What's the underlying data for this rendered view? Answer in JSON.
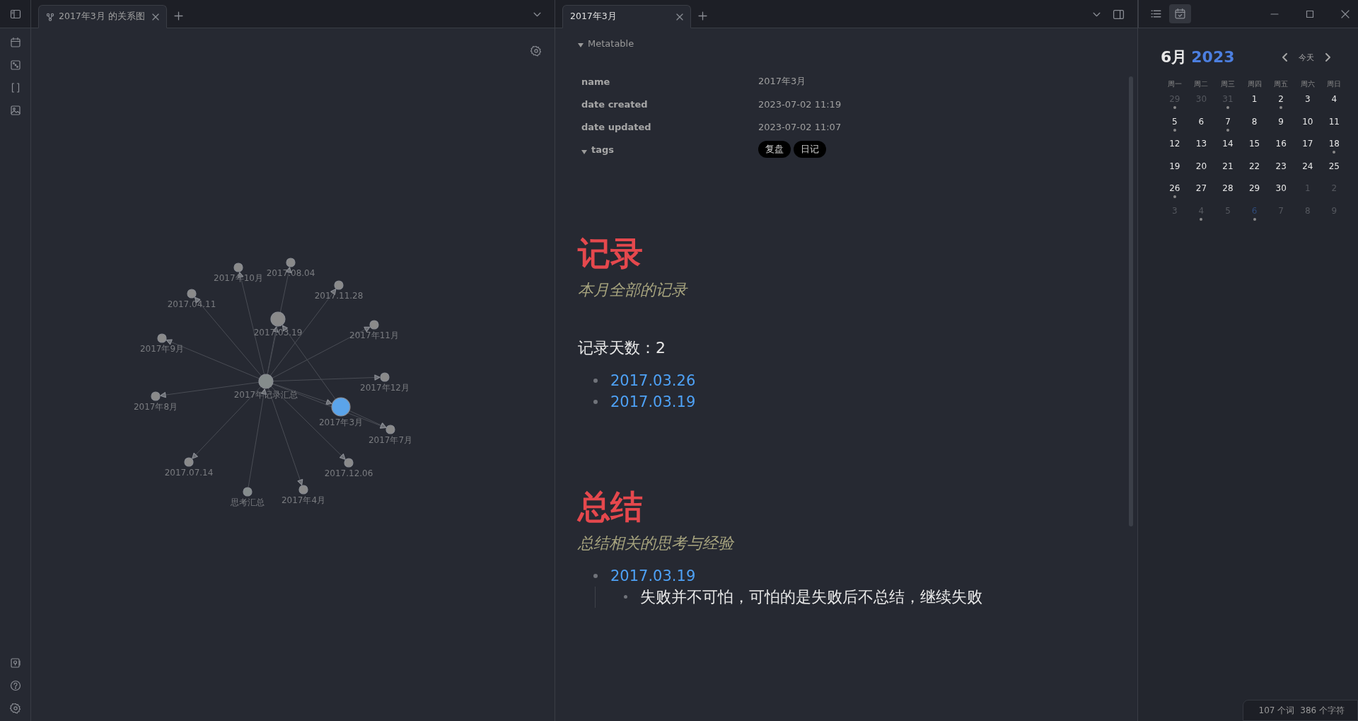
{
  "left_pane": {
    "tabs": [
      {
        "label": "2017年3月 的关系图",
        "selected": true
      }
    ],
    "graph": {
      "nodes": [
        {
          "label": "2017年记录汇总",
          "selected": false
        },
        {
          "label": "2017年3月",
          "selected": true
        },
        {
          "label": "2017.03.19",
          "selected": false
        },
        {
          "label": "2017年10月",
          "selected": false
        },
        {
          "label": "2017.08.04",
          "selected": false
        },
        {
          "label": "2017.04.11",
          "selected": false
        },
        {
          "label": "2017.11.28",
          "selected": false
        },
        {
          "label": "2017年11月",
          "selected": false
        },
        {
          "label": "2017年9月",
          "selected": false
        },
        {
          "label": "2017年12月",
          "selected": false
        },
        {
          "label": "2017年8月",
          "selected": false
        },
        {
          "label": "2017年7月",
          "selected": false
        },
        {
          "label": "2017.07.14",
          "selected": false
        },
        {
          "label": "2017.12.06",
          "selected": false
        },
        {
          "label": "思考汇总",
          "selected": false
        },
        {
          "label": "2017年4月",
          "selected": false
        }
      ]
    }
  },
  "middle_pane": {
    "tabs": [
      {
        "label": "2017年3月",
        "selected": true
      }
    ],
    "metatable": {
      "title": "Metatable",
      "expanded": true,
      "rows": [
        {
          "key": "name",
          "value": "2017年3月"
        },
        {
          "key": "date created",
          "value": "2023-07-02 11:19"
        },
        {
          "key": "date updated",
          "value": "2023-07-02 11:07"
        }
      ],
      "tags": {
        "key": "tags",
        "expanded": true,
        "items": [
          "复盘",
          "日记"
        ]
      }
    },
    "sections": [
      {
        "heading": "记录",
        "subtitle": "本月全部的记录",
        "paragraph": "记录天数：2",
        "items": [
          {
            "label": "2017.03.26"
          },
          {
            "label": "2017.03.19"
          }
        ]
      },
      {
        "heading": "总结",
        "subtitle": "总结相关的思考与经验",
        "items": [
          {
            "label": "2017.03.19",
            "children": [
              {
                "label": "失败并不可怕，可怕的是失败后不总结，继续失败"
              }
            ]
          }
        ]
      }
    ]
  },
  "calendar": {
    "month": "6月",
    "year": "2023",
    "today_button": "今天",
    "weekdays": [
      "周一",
      "周二",
      "周三",
      "周四",
      "周五",
      "周六",
      "周日"
    ],
    "days": [
      {
        "day": "29",
        "muted": true,
        "dot": true,
        "today": false
      },
      {
        "day": "30",
        "muted": true,
        "dot": false,
        "today": false
      },
      {
        "day": "31",
        "muted": true,
        "dot": true,
        "today": false
      },
      {
        "day": "1",
        "muted": false,
        "dot": false,
        "today": false
      },
      {
        "day": "2",
        "muted": false,
        "dot": true,
        "today": false
      },
      {
        "day": "3",
        "muted": false,
        "dot": false,
        "today": false
      },
      {
        "day": "4",
        "muted": false,
        "dot": false,
        "today": false
      },
      {
        "day": "5",
        "muted": false,
        "dot": true,
        "today": false
      },
      {
        "day": "6",
        "muted": false,
        "dot": false,
        "today": false
      },
      {
        "day": "7",
        "muted": false,
        "dot": true,
        "today": false
      },
      {
        "day": "8",
        "muted": false,
        "dot": false,
        "today": false
      },
      {
        "day": "9",
        "muted": false,
        "dot": false,
        "today": false
      },
      {
        "day": "10",
        "muted": false,
        "dot": false,
        "today": false
      },
      {
        "day": "11",
        "muted": false,
        "dot": false,
        "today": false
      },
      {
        "day": "12",
        "muted": false,
        "dot": false,
        "today": false
      },
      {
        "day": "13",
        "muted": false,
        "dot": false,
        "today": false
      },
      {
        "day": "14",
        "muted": false,
        "dot": false,
        "today": false
      },
      {
        "day": "15",
        "muted": false,
        "dot": false,
        "today": false
      },
      {
        "day": "16",
        "muted": false,
        "dot": false,
        "today": false
      },
      {
        "day": "17",
        "muted": false,
        "dot": false,
        "today": false
      },
      {
        "day": "18",
        "muted": false,
        "dot": true,
        "today": false
      },
      {
        "day": "19",
        "muted": false,
        "dot": false,
        "today": false
      },
      {
        "day": "20",
        "muted": false,
        "dot": false,
        "today": false
      },
      {
        "day": "21",
        "muted": false,
        "dot": false,
        "today": false
      },
      {
        "day": "22",
        "muted": false,
        "dot": false,
        "today": false
      },
      {
        "day": "23",
        "muted": false,
        "dot": false,
        "today": false
      },
      {
        "day": "24",
        "muted": false,
        "dot": false,
        "today": false
      },
      {
        "day": "25",
        "muted": false,
        "dot": false,
        "today": false
      },
      {
        "day": "26",
        "muted": false,
        "dot": true,
        "today": false
      },
      {
        "day": "27",
        "muted": false,
        "dot": false,
        "today": false
      },
      {
        "day": "28",
        "muted": false,
        "dot": false,
        "today": false
      },
      {
        "day": "29",
        "muted": false,
        "dot": false,
        "today": false
      },
      {
        "day": "30",
        "muted": false,
        "dot": false,
        "today": false
      },
      {
        "day": "1",
        "muted": true,
        "dot": false,
        "today": false
      },
      {
        "day": "2",
        "muted": true,
        "dot": false,
        "today": false
      },
      {
        "day": "3",
        "muted": true,
        "dot": false,
        "today": false
      },
      {
        "day": "4",
        "muted": true,
        "dot": true,
        "today": false
      },
      {
        "day": "5",
        "muted": true,
        "dot": false,
        "today": false
      },
      {
        "day": "6",
        "muted": true,
        "dot": true,
        "today": true
      },
      {
        "day": "7",
        "muted": true,
        "dot": false,
        "today": false
      },
      {
        "day": "8",
        "muted": true,
        "dot": false,
        "today": false
      },
      {
        "day": "9",
        "muted": true,
        "dot": false,
        "today": false
      }
    ]
  },
  "status_bar": {
    "words": "107 个词",
    "chars": "386 个字符"
  }
}
